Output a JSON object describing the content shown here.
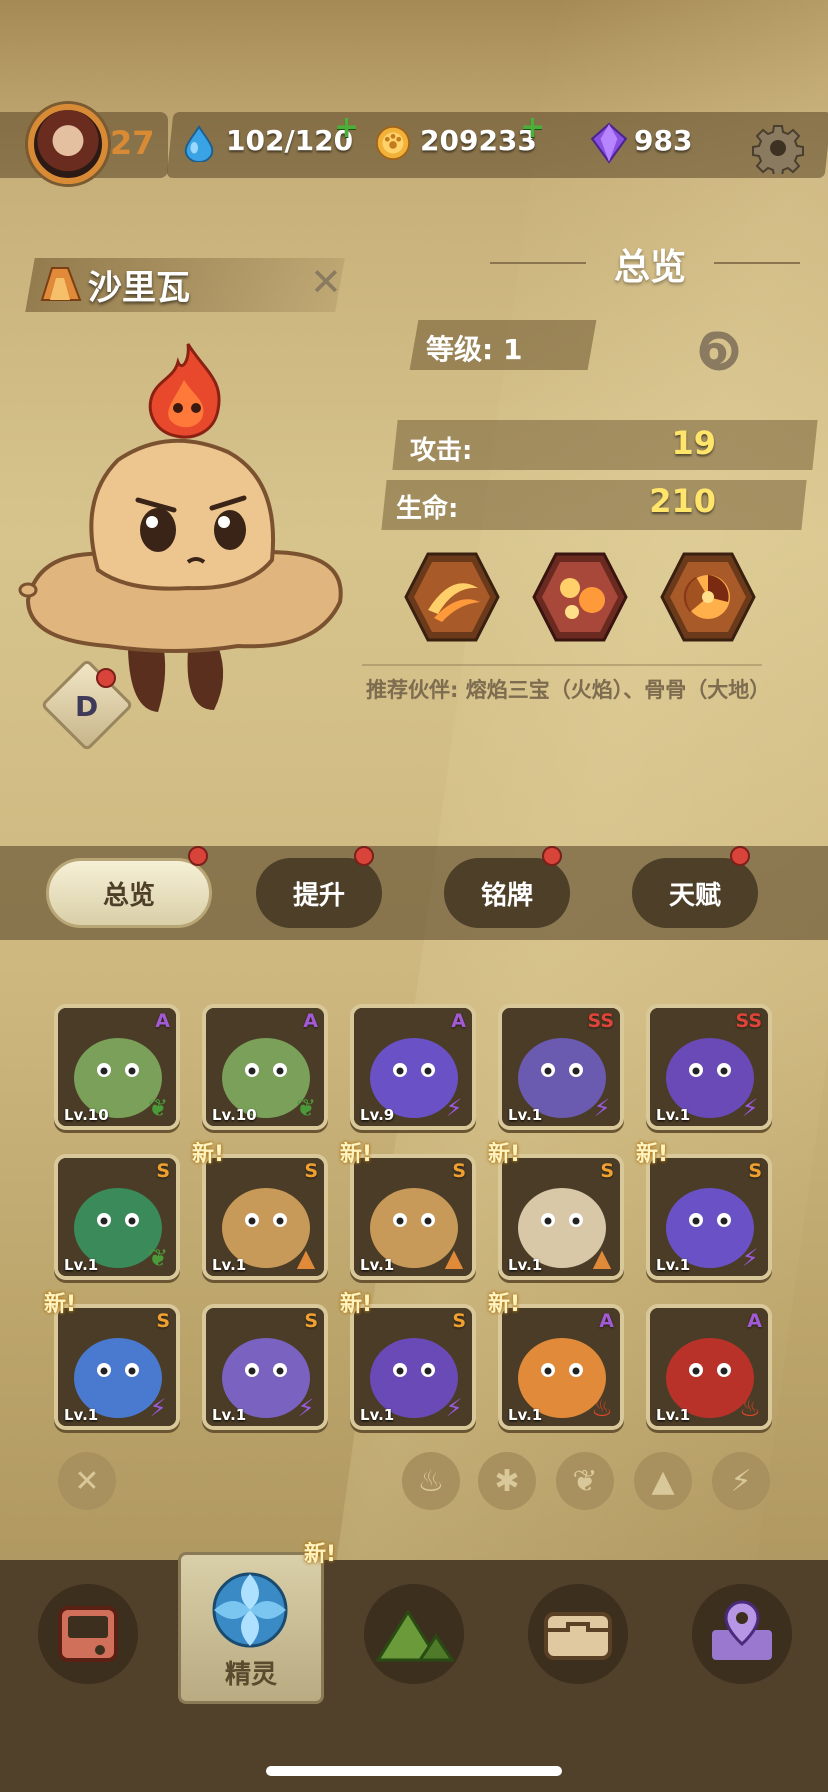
{
  "player": {
    "level": "27",
    "water": "102/120",
    "coins": "209233",
    "gems": "983"
  },
  "spirit": {
    "name": "沙里瓦",
    "grade": "D"
  },
  "overview": {
    "title": "总览",
    "level_label": "等级: 1",
    "attack_label": "攻击:",
    "attack_value": "19",
    "hp_label": "生命:",
    "hp_value": "210",
    "recommend": "推荐伙伴: 熔焰三宝（火焰）、骨骨（大地）"
  },
  "tabs": [
    {
      "label": "总览",
      "active": true
    },
    {
      "label": "提升"
    },
    {
      "label": "铭牌"
    },
    {
      "label": "天赋"
    }
  ],
  "cards": [
    {
      "lv": "Lv.10",
      "rank": "A",
      "elem": "leaf",
      "new": false
    },
    {
      "lv": "Lv.10",
      "rank": "A",
      "elem": "leaf",
      "new": false
    },
    {
      "lv": "Lv.9",
      "rank": "A",
      "elem": "bolt",
      "new": false
    },
    {
      "lv": "Lv.1",
      "rank": "SS",
      "elem": "bolt",
      "new": false
    },
    {
      "lv": "Lv.1",
      "rank": "SS",
      "elem": "bolt",
      "new": false
    },
    {
      "lv": "Lv.1",
      "rank": "S",
      "elem": "leaf",
      "new": false
    },
    {
      "lv": "Lv.1",
      "rank": "S",
      "elem": "earth",
      "new": true
    },
    {
      "lv": "Lv.1",
      "rank": "S",
      "elem": "earth",
      "new": true
    },
    {
      "lv": "Lv.1",
      "rank": "S",
      "elem": "earth",
      "new": true
    },
    {
      "lv": "Lv.1",
      "rank": "S",
      "elem": "bolt",
      "new": true
    },
    {
      "lv": "Lv.1",
      "rank": "S",
      "elem": "bolt",
      "new": true
    },
    {
      "lv": "Lv.1",
      "rank": "S",
      "elem": "bolt",
      "new": false
    },
    {
      "lv": "Lv.1",
      "rank": "S",
      "elem": "bolt",
      "new": true
    },
    {
      "lv": "Lv.1",
      "rank": "A",
      "elem": "fire",
      "new": true
    },
    {
      "lv": "Lv.1",
      "rank": "A",
      "elem": "fire",
      "new": false
    }
  ],
  "new_label": "新!",
  "nav": {
    "active_label": "精灵"
  },
  "colors": {
    "rank_A": "#a25ad6",
    "rank_S": "#f0a030",
    "rank_SS": "#e0433a",
    "accent": "#d98a35"
  }
}
